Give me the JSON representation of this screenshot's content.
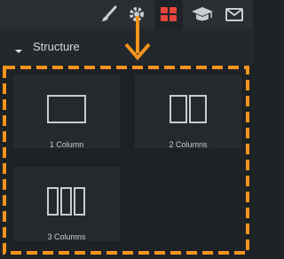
{
  "toolbar": {
    "icons": [
      "brush-icon",
      "gear-icon",
      "grid-icon",
      "graduation-cap-icon",
      "mail-icon"
    ],
    "active": "grid-icon"
  },
  "section": {
    "title": "Structure"
  },
  "layouts": [
    {
      "label": "1 Column",
      "columns": 1
    },
    {
      "label": "2 Columns",
      "columns": 2
    },
    {
      "label": "3 Columns",
      "columns": 3
    }
  ],
  "colors": {
    "highlight": "#f7941d",
    "active_icon": "#e8443a",
    "icon": "#c9ccd0"
  }
}
